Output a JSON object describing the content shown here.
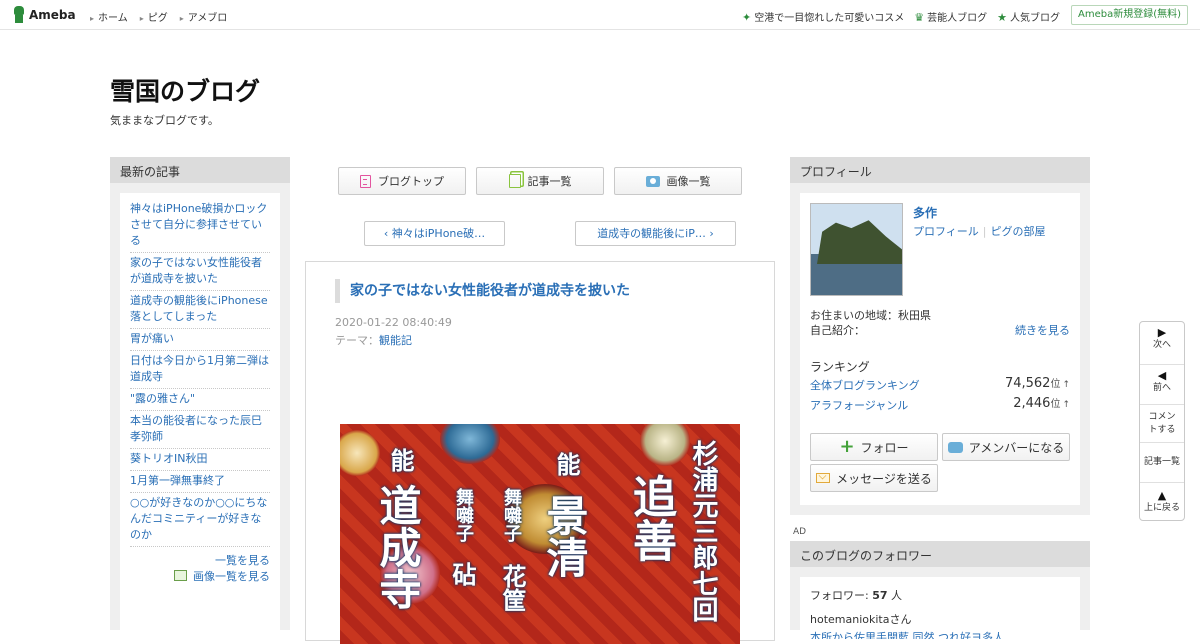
{
  "header": {
    "logo": "Ameba",
    "nav_left": [
      "ホーム",
      "ピグ",
      "アメブロ"
    ],
    "nav_right": [
      "空港で一目惚れした可愛いコスメ",
      "芸能人ブログ",
      "人気ブログ"
    ],
    "signup": "Ameba新規登録(無料)"
  },
  "blog": {
    "title": "雪国のブログ",
    "description": "気ままなブログです。"
  },
  "recent": {
    "heading": "最新の記事",
    "items": [
      "神々はiPHone破損かロックさせて自分に参拝させている",
      "家の子ではない女性能役者が道成寺を披いた",
      "道成寺の観能後にiPhonese落としてしまった",
      "胃が痛い",
      "日付は今日から1月第二弾は道成寺",
      "\"露の雅さん\"",
      "本当の能役者になった辰巳孝弥師",
      "葵トリオIN秋田",
      "1月第一弾無事終了",
      "○○が好きなのか○○にちなんだコミニティーが好きなのか"
    ],
    "see_all": "一覧を見る",
    "see_images": "画像一覧を見る"
  },
  "center_nav": {
    "blog_top": "ブログトップ",
    "articles": "記事一覧",
    "images": "画像一覧"
  },
  "pager": {
    "prev": "神々はiPHone破…",
    "next": "道成寺の観能後にiP…"
  },
  "article": {
    "title": "家の子ではない女性能役者が道成寺を披いた",
    "date": "2020-01-22 08:40:49",
    "theme_label": "テーマ：",
    "theme": "観能記",
    "image_text": {
      "col1": "杉浦元三郎七回",
      "col2": "追善",
      "col3": "能",
      "col4": "景清",
      "col5": "舞囃子",
      "col6": "花筐",
      "col7": "舞囃子",
      "col8": "砧",
      "col9": "能",
      "col10": "道成寺"
    }
  },
  "profile": {
    "heading": "プロフィール",
    "name": "多作",
    "link_profile": "プロフィール",
    "link_pig": "ピグの部屋",
    "location": "お住まいの地域：秋田県",
    "self_intro": "自己紹介：",
    "more": "続きを見る",
    "ranking_label": "ランキング",
    "rankings": [
      {
        "name": "全体ブログランキング",
        "value": "74,562",
        "unit": "位",
        "trend": "↑"
      },
      {
        "name": "アラフォージャンル",
        "value": "2,446",
        "unit": "位",
        "trend": "↑"
      }
    ],
    "follow": "フォロー",
    "amember": "アメンバーになる",
    "message": "メッセージを送る"
  },
  "ad_label": "AD",
  "followers": {
    "heading": "このブログのフォロワー",
    "count_label": "フォロワー: ",
    "count": "57",
    "count_unit": " 人",
    "user": "hotemaniokitaさん",
    "links": "本所から佐里手開藍 同然 つれ好ヨ多人"
  },
  "float_nav": {
    "next": "次へ",
    "prev": "前へ",
    "comment": "コメントする",
    "list": "記事一覧",
    "top": "上に戻る"
  },
  "colors": {
    "link": "#2a6fb6",
    "ameba_green": "#2d8c3c",
    "sidebar_bg": "#efefef",
    "heading_bg": "#dcdcdc"
  }
}
